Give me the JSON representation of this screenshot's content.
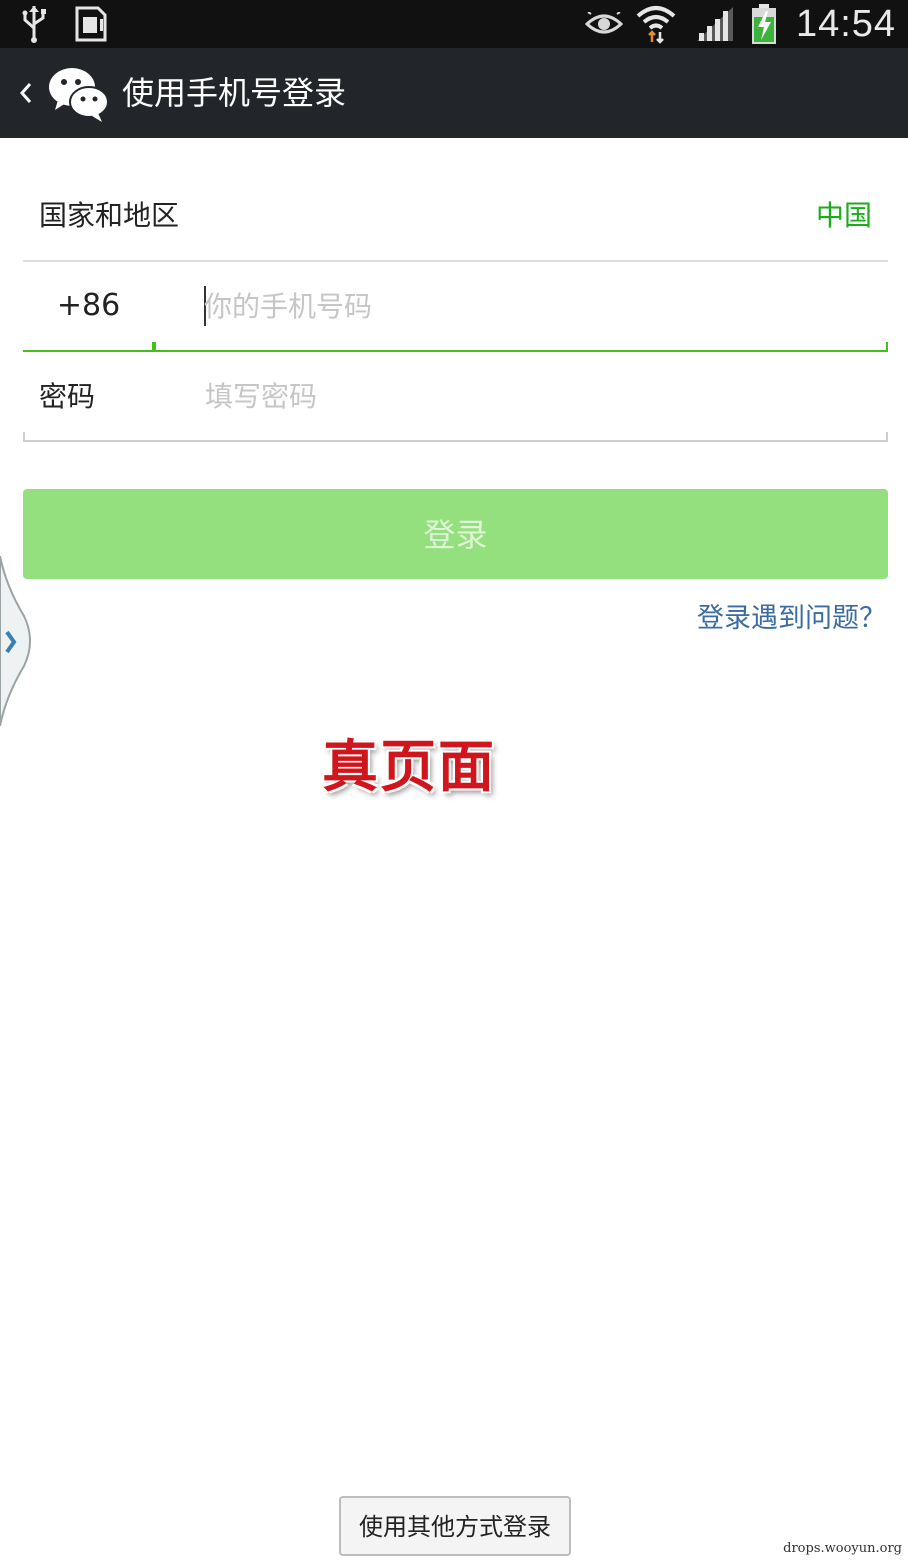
{
  "status_bar": {
    "time": "14:54",
    "icons": [
      "usb-icon",
      "sim-card-icon",
      "eye-icon",
      "wifi-icon",
      "signal-icon",
      "battery-charging-icon"
    ]
  },
  "title_bar": {
    "title": "使用手机号登录",
    "icons": [
      "back-chevron-icon",
      "wechat-logo-icon"
    ]
  },
  "form": {
    "region_label": "国家和地区",
    "region_value": "中国",
    "country_code": "+86",
    "phone_placeholder": "你的手机号码",
    "phone_value": "",
    "password_label": "密码",
    "password_placeholder": "填写密码",
    "password_value": ""
  },
  "actions": {
    "login_label": "登录",
    "login_help_label": "登录遇到问题？",
    "other_login_label": "使用其他方式登录"
  },
  "annotation": {
    "text": "真页面"
  },
  "watermark": "drops.wooyun.org",
  "colors": {
    "accent_green": "#1aad19",
    "login_button_disabled": "#94df7e",
    "link_blue": "#3a6ca3",
    "annotation_red": "#d0161c",
    "title_bar_bg": "#22262a"
  }
}
